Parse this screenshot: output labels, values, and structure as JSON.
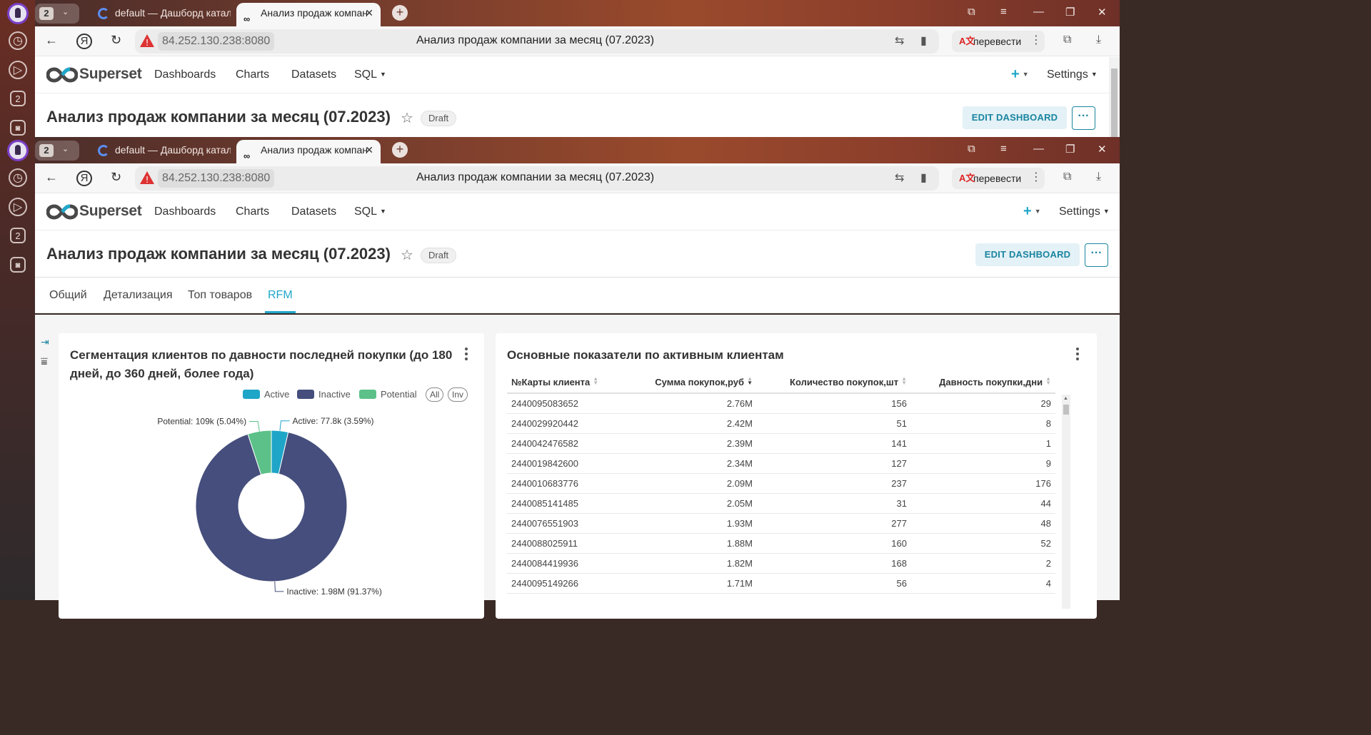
{
  "side": {
    "tab_count_badge": "2"
  },
  "browser": {
    "tab_count": "2",
    "tabs": [
      {
        "label": "default — Дашборд катал"
      },
      {
        "label": "Анализ продаж компан"
      }
    ],
    "host": "84.252.130.238:8080",
    "page_title": "Анализ продаж компании за месяц (07.2023)",
    "translate_label": "перевести"
  },
  "superset": {
    "brand": "Superset",
    "nav": [
      "Dashboards",
      "Charts",
      "Datasets",
      "SQL"
    ],
    "plus": "+",
    "settings": "Settings"
  },
  "dashboard": {
    "title": "Анализ продаж компании за месяц (07.2023)",
    "status": "Draft",
    "edit_label": "EDIT DASHBOARD",
    "more_label": "···",
    "tabs": [
      "Общий",
      "Детализация",
      "Топ товаров",
      "RFM"
    ],
    "active_tab": "RFM"
  },
  "colors": {
    "active": "#1fa5c8",
    "inactive": "#454e7c",
    "potential": "#5bc189",
    "accent": "#20a7c9"
  },
  "pie_card": {
    "title": "Сегментация клиентов по давности последней покупки (до 180 дней, до 360 дней, более года)",
    "legend_all": "All",
    "legend_inv": "Inv"
  },
  "chart_data": {
    "type": "pie",
    "title": "Сегментация клиентов по давности последней покупки (до 180 дней, до 360 дней, более года)",
    "legend_placement": "top-right",
    "donut": true,
    "slices": [
      {
        "name": "Active",
        "value": 77800,
        "percent": 3.59,
        "label": "Active: 77.8k (3.59%)",
        "color": "#1fa5c8"
      },
      {
        "name": "Inactive",
        "value": 1980000,
        "percent": 91.37,
        "label": "Inactive: 1.98M (91.37%)",
        "color": "#454e7c"
      },
      {
        "name": "Potential",
        "value": 109000,
        "percent": 5.04,
        "label": "Potential: 109k (5.04%)",
        "color": "#5bc189"
      }
    ]
  },
  "table_card": {
    "title": "Основные показатели по активным клиентам",
    "columns": [
      "№Карты клиента",
      "Сумма покупок,руб",
      "Количество покупок,шт",
      "Давность покупки,дни"
    ],
    "rows": [
      [
        "2440095083652",
        "2.76M",
        "156",
        "29"
      ],
      [
        "2440029920442",
        "2.42M",
        "51",
        "8"
      ],
      [
        "2440042476582",
        "2.39M",
        "141",
        "1"
      ],
      [
        "2440019842600",
        "2.34M",
        "127",
        "9"
      ],
      [
        "2440010683776",
        "2.09M",
        "237",
        "176"
      ],
      [
        "2440085141485",
        "2.05M",
        "31",
        "44"
      ],
      [
        "2440076551903",
        "1.93M",
        "277",
        "48"
      ],
      [
        "2440088025911",
        "1.88M",
        "160",
        "52"
      ],
      [
        "2440084419936",
        "1.82M",
        "168",
        "2"
      ],
      [
        "2440095149266",
        "1.71M",
        "56",
        "4"
      ]
    ]
  }
}
